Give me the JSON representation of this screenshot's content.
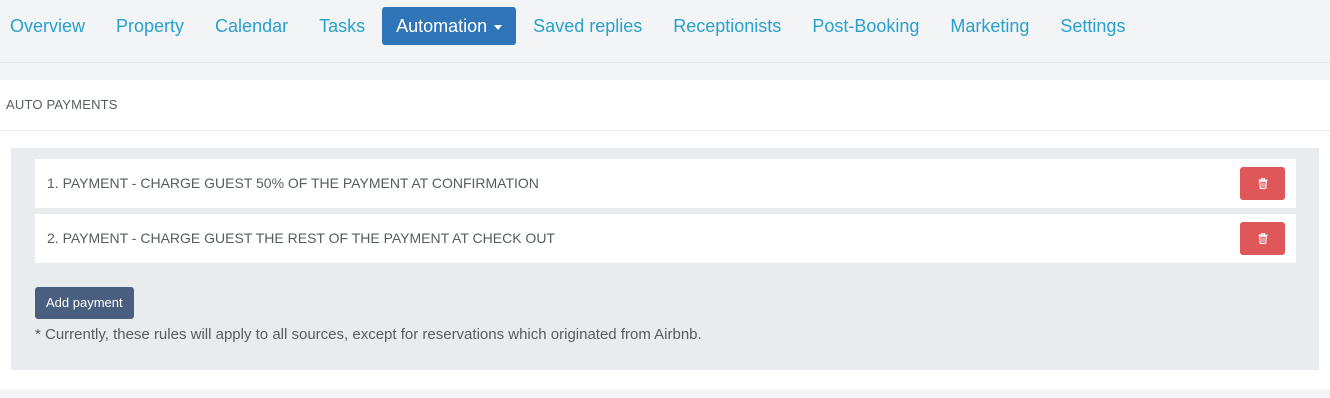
{
  "nav": {
    "items": [
      {
        "label": "Overview"
      },
      {
        "label": "Property"
      },
      {
        "label": "Calendar"
      },
      {
        "label": "Tasks"
      },
      {
        "label": "Automation",
        "active": true,
        "dropdown": true
      },
      {
        "label": "Saved replies"
      },
      {
        "label": "Receptionists"
      },
      {
        "label": "Post-Booking"
      },
      {
        "label": "Marketing"
      },
      {
        "label": "Settings"
      }
    ]
  },
  "panel": {
    "title": "AUTO PAYMENTS",
    "rules": [
      {
        "text": "1. PAYMENT - CHARGE GUEST 50% OF THE PAYMENT AT CONFIRMATION",
        "delete_icon": "trash-icon"
      },
      {
        "text": "2. PAYMENT - CHARGE GUEST THE REST OF THE PAYMENT AT CHECK OUT",
        "delete_icon": "trash-icon"
      }
    ],
    "add_button_label": "Add payment",
    "note": "* Currently, these rules will apply to all sources, except for reservations which originated from Airbnb."
  },
  "colors": {
    "link": "#2aa0cc",
    "active_tab": "#2f75b8",
    "delete": "#e0575a",
    "add_button": "#4a5e80"
  }
}
